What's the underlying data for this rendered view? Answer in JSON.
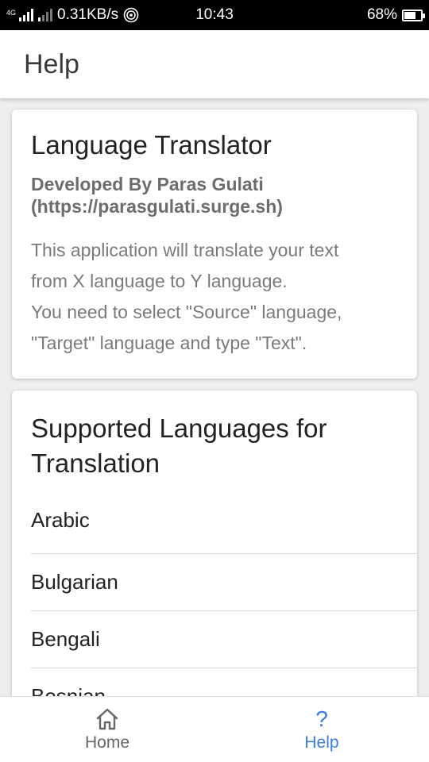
{
  "status_bar": {
    "network_tag": "4G",
    "net_speed": "0.31KB/s",
    "time": "10:43",
    "battery": "68%",
    "battery_level": 0.68
  },
  "app_bar": {
    "title": "Help"
  },
  "about_card": {
    "title": "Language Translator",
    "developer_line1": "Developed By Paras Gulati",
    "developer_line2": "(https://parasgulati.surge.sh)",
    "description_line1": "This application will translate your text",
    "description_line2": "from X language to Y language.",
    "description_line3": "You need to select \"Source\" language,",
    "description_line4": "\"Target\" language and type \"Text\"."
  },
  "languages_card": {
    "title": "Supported Languages for Translation",
    "languages": [
      "Arabic",
      "Bulgarian",
      "Bengali",
      "Bosnian"
    ]
  },
  "bottom_nav": {
    "items": [
      {
        "label": "Home",
        "icon": "home-icon"
      },
      {
        "label": "Help",
        "icon": "help-icon",
        "active": true
      }
    ],
    "active_color": "#3b7ddd",
    "inactive_color": "#666666"
  }
}
